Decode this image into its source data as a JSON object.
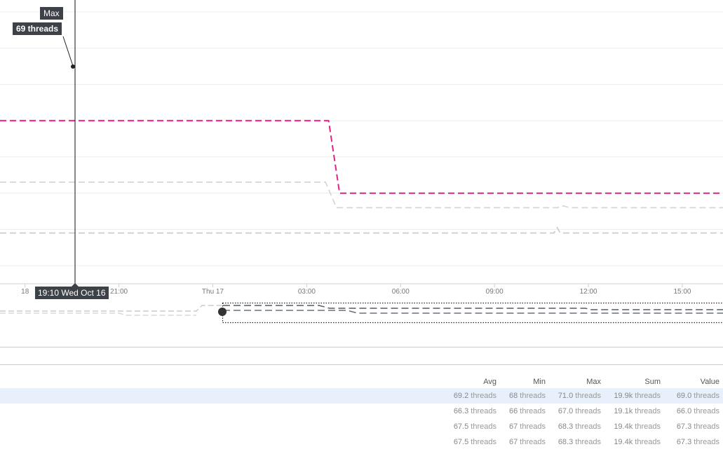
{
  "chart_data": {
    "type": "line",
    "x_tick_labels": [
      "18",
      "21:00",
      "Thu 17",
      "03:00",
      "06:00",
      "09:00",
      "12:00",
      "15:00"
    ],
    "x_unit": "hours since Wed Oct 16 18:00",
    "x_ticks": [
      0,
      3,
      6,
      9,
      12,
      15,
      18,
      21
    ],
    "xlim": [
      -0.8,
      22.3
    ],
    "ylim": [
      64.5,
      72.0
    ],
    "ygrid": [
      65,
      66,
      67,
      68,
      69,
      70,
      71,
      72
    ],
    "grid": "horizontal",
    "series": [
      {
        "color": "#e0218a",
        "style": "dashed",
        "x": [
          -0.8,
          9.7,
          10.05,
          22.3
        ],
        "values": [
          69.0,
          69.0,
          67.0,
          67.0
        ]
      },
      {
        "color": "#d4d4d4",
        "style": "dashed",
        "x": [
          -0.8,
          9.6,
          9.95,
          17.0,
          17.2,
          17.4,
          22.3
        ],
        "values": [
          67.3,
          67.3,
          66.6,
          66.6,
          66.65,
          66.6,
          66.6
        ]
      },
      {
        "color": "#c9c9c9",
        "style": "dashed",
        "x": [
          -0.8,
          16.9,
          17.0,
          17.1,
          22.3
        ],
        "values": [
          65.9,
          65.9,
          66.05,
          65.9,
          65.9
        ]
      }
    ]
  },
  "tooltip": {
    "series": "Max",
    "value": "69 threads",
    "time": "19:10 Wed Oct 16"
  },
  "table": {
    "headers": {
      "avg": "Avg",
      "min": "Min",
      "max": "Max",
      "sum": "Sum",
      "value": "Value"
    },
    "unit": "threads",
    "rows": [
      {
        "avg": "69.2",
        "min": "68",
        "max": "71.0",
        "sum": "19.9k",
        "value": "69.0"
      },
      {
        "avg": "66.3",
        "min": "66",
        "max": "67.0",
        "sum": "19.1k",
        "value": "66.0"
      },
      {
        "avg": "67.5",
        "min": "67",
        "max": "68.3",
        "sum": "19.4k",
        "value": "67.3"
      },
      {
        "avg": "67.5",
        "min": "67",
        "max": "68.3",
        "sum": "19.4k",
        "value": "67.3"
      }
    ]
  }
}
